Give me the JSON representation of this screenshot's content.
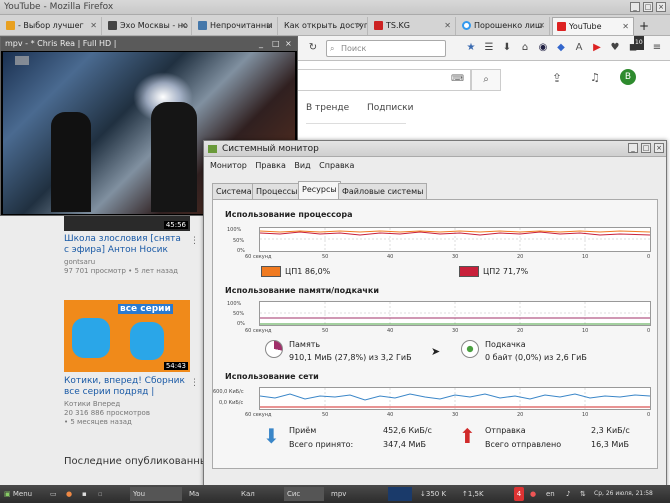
{
  "firefox": {
    "title": "YouTube - Mozilla Firefox",
    "tabs": [
      {
        "label": "- Выбор лучшег",
        "color": "#e8a020"
      },
      {
        "label": "Эхо Москвы - но",
        "color": "#444444"
      },
      {
        "label": "Непрочитанны",
        "color": "#4477aa"
      },
      {
        "label": "Как открыть доступ",
        "color": "#eeeeee"
      },
      {
        "label": "TS.KG",
        "color": "#cc2222"
      },
      {
        "label": "Порошенко лиш",
        "color": "#3399ee"
      },
      {
        "label": "YouTube",
        "color": "#dd2222"
      }
    ],
    "new_tab": "+",
    "search_placeholder": "Поиск",
    "notif_count": "10"
  },
  "youtube": {
    "tabs": [
      "В тренде",
      "Подписки"
    ],
    "avatar_letter": "В",
    "videos": [
      {
        "duration": "45:56",
        "title_lines": [
          "Школа злословия [снята",
          "с эфира] Антон Носик"
        ],
        "channel": "gontsaru",
        "meta": "97 701 просмотр  •  5 лет назад"
      },
      {
        "duration": "54:43",
        "thumb_text": "все серии",
        "title_lines": [
          "Котики, вперед! Сборник",
          "все серии подряд |"
        ],
        "channel": "Котики Вперед",
        "meta": "20 316 886 просмотров",
        "meta2": "•  5 месяцев назад"
      }
    ],
    "last_published": "Последние опубликованны"
  },
  "mpv": {
    "title": "mpv - * Chris Rea | Full HD |"
  },
  "sysmon": {
    "title": "Системный монитор",
    "menu": [
      "Монитор",
      "Правка",
      "Вид",
      "Справка"
    ],
    "tabs": [
      "Система",
      "Процессы",
      "Ресурсы",
      "Файловые системы"
    ],
    "active_tab": "Ресурсы",
    "cpu": {
      "heading": "Использование процессора",
      "y_top": "100%",
      "y_mid": "50%",
      "y_bot": "0%",
      "x_labels": [
        "60 секунд",
        "50",
        "40",
        "30",
        "20",
        "10",
        "0"
      ],
      "cpu1_label": "ЦП1  86,0%",
      "cpu1_color": "#f07a20",
      "cpu2_label": "ЦП2  71,7%",
      "cpu2_color": "#c8203a"
    },
    "mem": {
      "heading": "Использование памяти/подкачки",
      "y_top": "100%",
      "y_mid": "50%",
      "y_bot": "0%",
      "x_labels": [
        "60 секунд",
        "50",
        "40",
        "30",
        "20",
        "10",
        "0"
      ],
      "mem_label": "Память",
      "mem_value": "910,1 МиБ (27,8%) из 3,2 ГиБ",
      "swap_label": "Подкачка",
      "swap_value": "0 байт (0,0%) из 2,6 ГиБ"
    },
    "net": {
      "heading": "Использование сети",
      "y_top": "600,0 КиБ/с",
      "y_bot": "0,0 КиБ/с",
      "x_labels": [
        "60 секунд",
        "50",
        "40",
        "30",
        "20",
        "10",
        "0"
      ],
      "recv_label": "Приём",
      "recv_rate": "452,6 КиБ/с",
      "recv_total_label": "Всего принято:",
      "recv_total": "347,4 МиБ",
      "send_label": "Отправка",
      "send_rate": "2,3 КиБ/с",
      "send_total_label": "Всего отправлено",
      "send_total": "16,3 МиБ"
    }
  },
  "taskbar": {
    "menu": "Menu",
    "items": [
      "You",
      "Ма",
      "Кал",
      "Сис",
      "mpv"
    ],
    "net_down": "350 K",
    "net_up": "1,5K",
    "lang": "en",
    "badge": "4",
    "clock": "Ср, 26 июля, 21:58"
  }
}
